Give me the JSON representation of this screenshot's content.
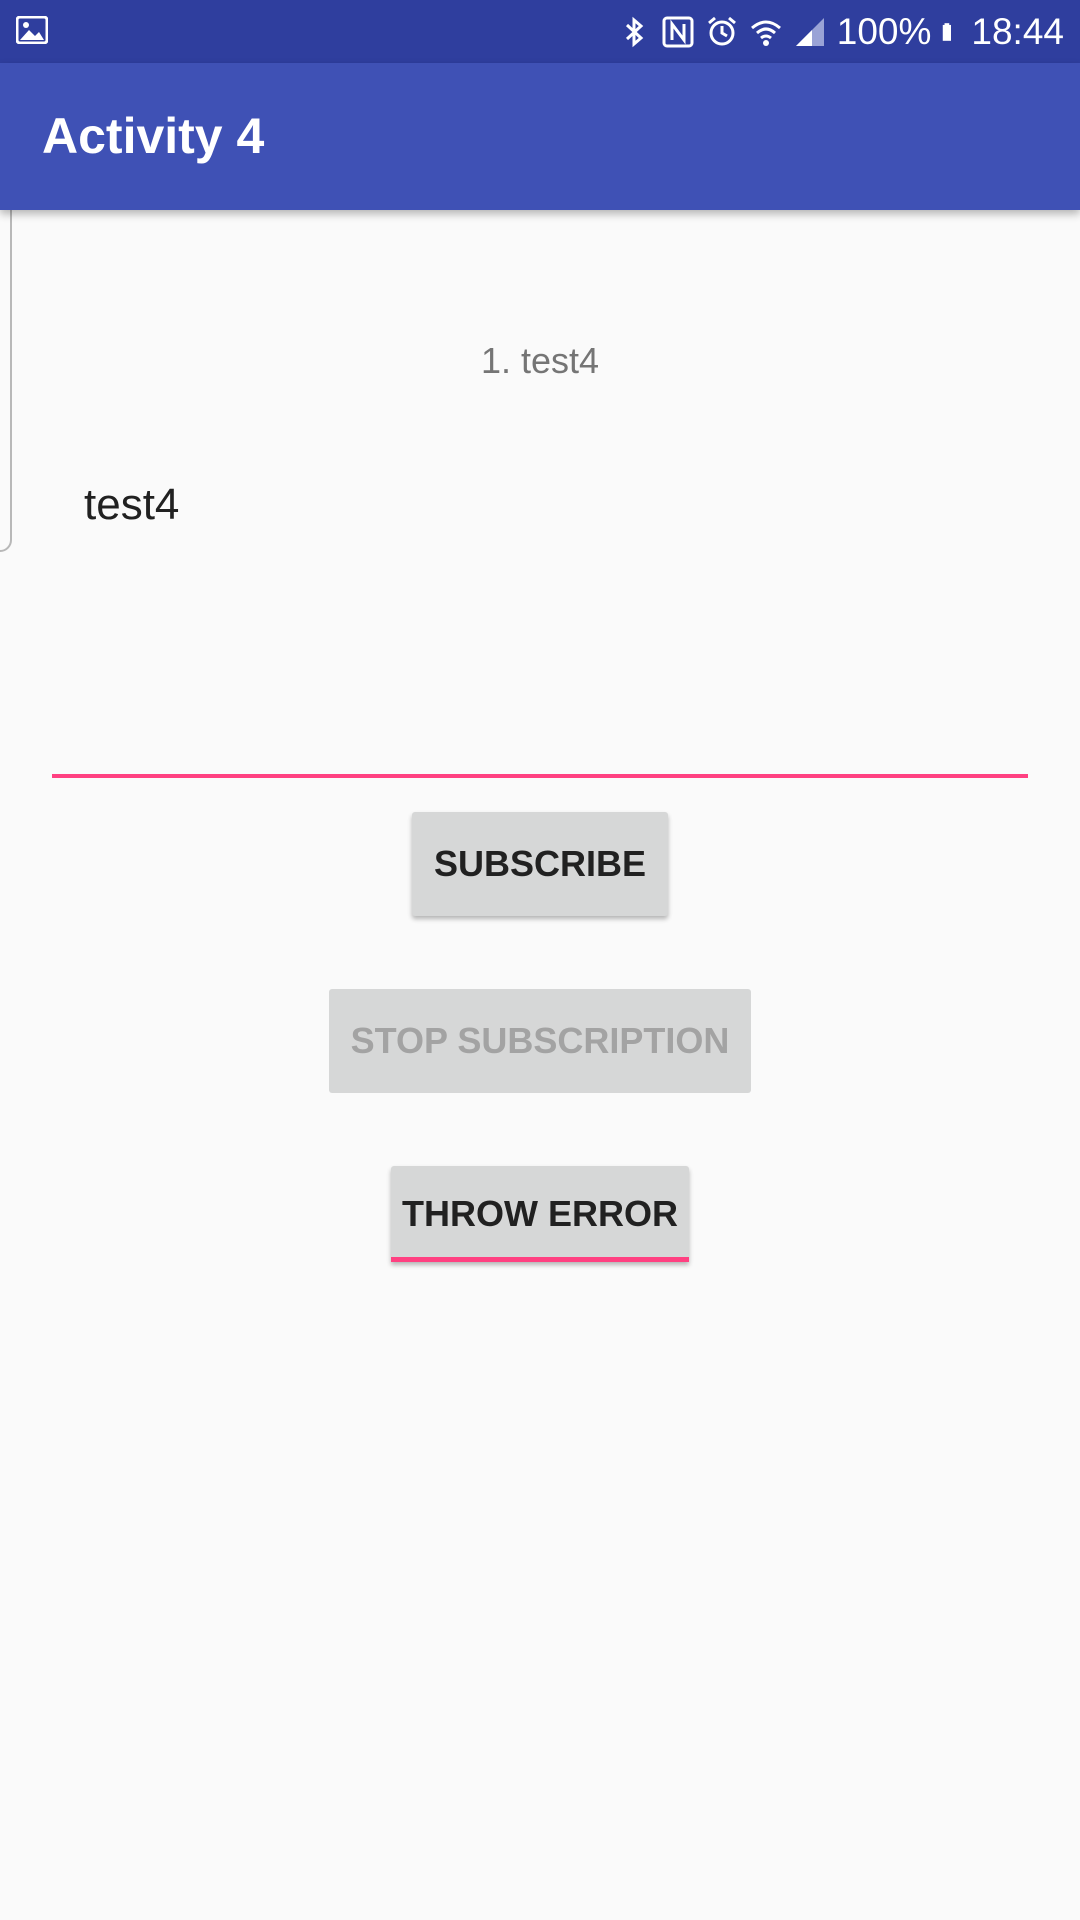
{
  "status_bar": {
    "battery_percent": "100%",
    "time": "18:44",
    "icons": [
      "gallery-icon",
      "bluetooth-icon",
      "nfc-icon",
      "alarm-icon",
      "wifi-icon",
      "signal-icon",
      "battery-icon"
    ],
    "background": "#2f3e9e"
  },
  "app_bar": {
    "title": "Activity 4",
    "background": "#3f51b5"
  },
  "main": {
    "list": [
      "1. test4"
    ],
    "text_input": {
      "value": "test4",
      "underline_color": "#ff4081"
    },
    "buttons": {
      "subscribe": "SUBSCRIBE",
      "stop_subscription": "STOP SUBSCRIPTION",
      "throw_error": "THROW ERROR"
    }
  },
  "colors": {
    "accent": "#ff4081",
    "button_background": "#d6d7d7",
    "disabled_text": "#a3a3a3"
  }
}
